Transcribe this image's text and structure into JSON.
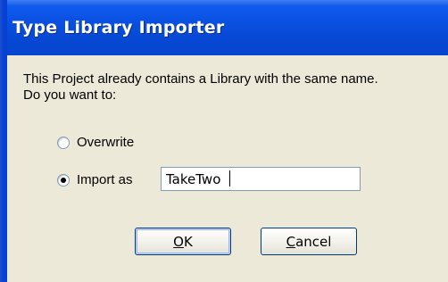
{
  "window": {
    "title": "Type Library Importer"
  },
  "dialog": {
    "message_line1": "This Project already contains a Library with the same name.",
    "message_line2": "Do you want to:",
    "options": [
      {
        "label": "Overwrite",
        "selected": false
      },
      {
        "label": "Import as",
        "selected": true
      }
    ],
    "import_name_value": "TakeTwo",
    "ok_label_underlined": "O",
    "ok_label_rest": "K",
    "cancel_label_underlined": "C",
    "cancel_label_rest": "ancel"
  },
  "colors": {
    "titlebar": "#0a50e0",
    "face": "#ece9d8",
    "button_border": "#003c74"
  }
}
